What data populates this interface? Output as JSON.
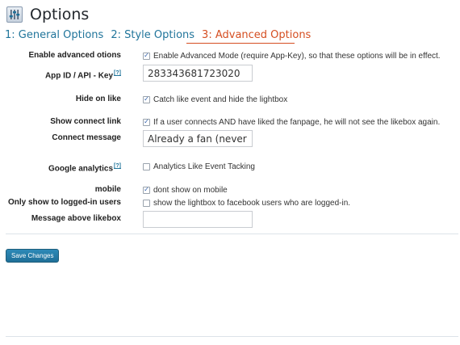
{
  "header": {
    "title": "Options",
    "icon": "settings-sliders-icon"
  },
  "tabs": [
    {
      "label": "1: General Options",
      "active": false
    },
    {
      "label": "2: Style Options",
      "active": false
    },
    {
      "label": "3: Advanced Options",
      "active": true
    }
  ],
  "form": {
    "advanced": {
      "label": "Enable advanced otions",
      "checked": true,
      "text": "Enable Advanced Mode (require App-Key), so that these options will be in effect."
    },
    "app_id": {
      "label": "App ID / API - Key",
      "help": "[?]",
      "value": "283343681723020"
    },
    "hide_on_like": {
      "label": "Hide on like",
      "checked": true,
      "text": "Catch like event and hide the lightbox"
    },
    "show_connect": {
      "label": "Show connect link",
      "checked": true,
      "text": "If a user connects AND have liked the fanpage, he will not see the likebox again."
    },
    "connect_message": {
      "label": "Connect message",
      "value": "Already a fan (never show"
    },
    "google_analytics": {
      "label": "Google analytics",
      "help": "[?]",
      "checked": false,
      "text": "Analytics Like Event Tacking"
    },
    "mobile": {
      "label": "mobile",
      "checked": true,
      "text": "dont show on mobile"
    },
    "logged_in": {
      "label": "Only show to logged-in users",
      "checked": false,
      "text": "show the lightbox to facebook users who are logged-in."
    },
    "message_above": {
      "label": "Message above likebox",
      "value": ""
    }
  },
  "actions": {
    "save_label": "Save Changes"
  },
  "colors": {
    "link": "#21759b",
    "active_tab": "#d54e21",
    "button": "#21759b"
  }
}
